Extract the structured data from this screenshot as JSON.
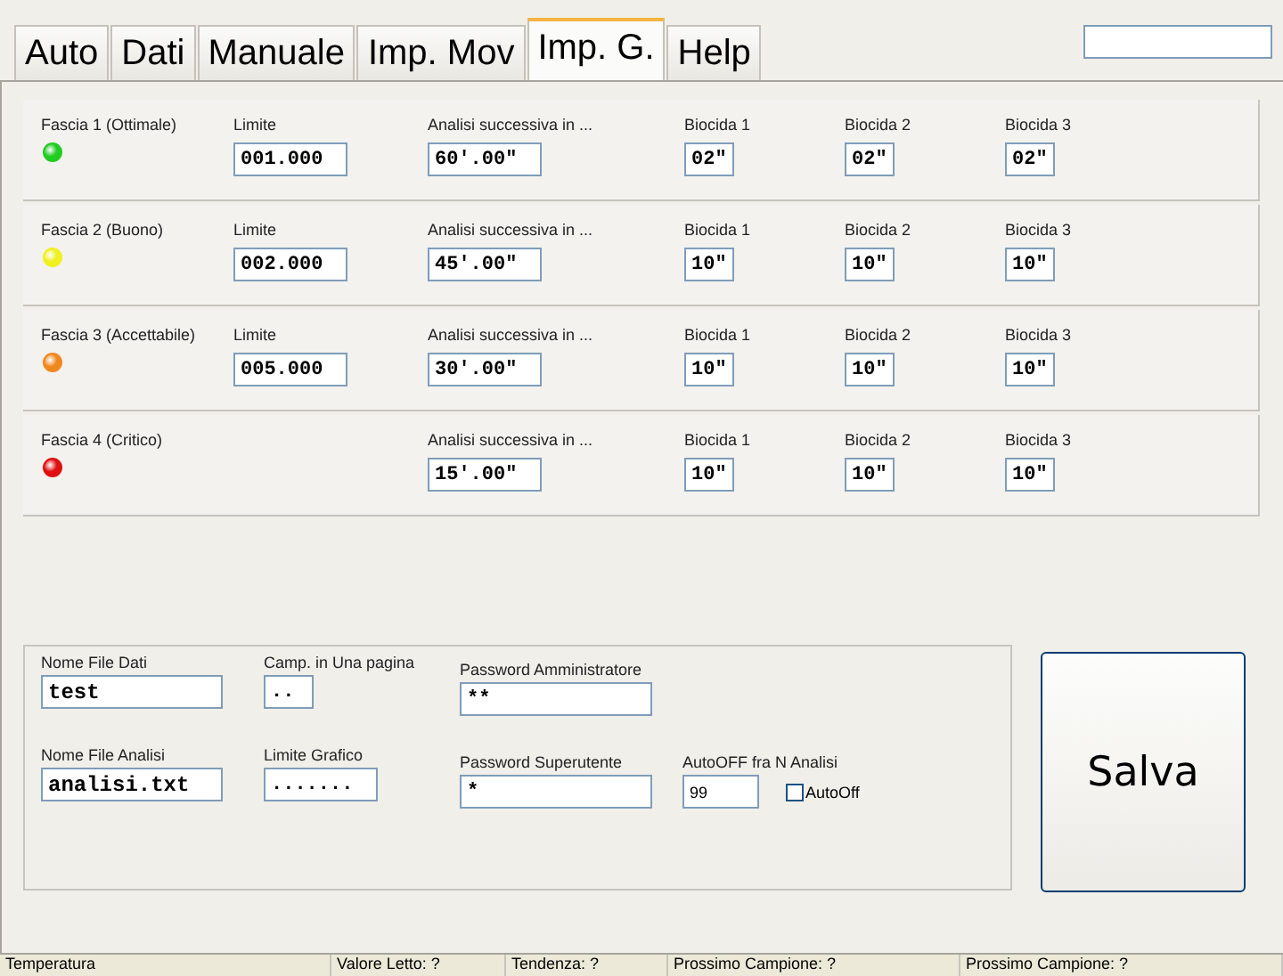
{
  "tabs": [
    {
      "label": "Auto",
      "selected": false
    },
    {
      "label": "Dati",
      "selected": false
    },
    {
      "label": "Manuale",
      "selected": false
    },
    {
      "label": "Imp. Mov",
      "selected": false
    },
    {
      "label": "Imp. G.",
      "selected": true
    },
    {
      "label": "Help",
      "selected": false
    }
  ],
  "bands": [
    {
      "name": "Fascia 1 (Ottimale)",
      "color": "#22cc22",
      "limit": {
        "label": "Limite",
        "value": "001.000"
      },
      "next_analysis": {
        "label": "Analisi successiva in ...",
        "value": "60'.00\""
      },
      "biocides": [
        {
          "label": "Biocida 1",
          "value": "02\""
        },
        {
          "label": "Biocida 2",
          "value": "02\""
        },
        {
          "label": "Biocida 3",
          "value": "02\""
        }
      ]
    },
    {
      "name": "Fascia 2 (Buono)",
      "color": "#f0f020",
      "limit": {
        "label": "Limite",
        "value": "002.000"
      },
      "next_analysis": {
        "label": "Analisi successiva in ...",
        "value": "45'.00\""
      },
      "biocides": [
        {
          "label": "Biocida 1",
          "value": "10\""
        },
        {
          "label": "Biocida 2",
          "value": "10\""
        },
        {
          "label": "Biocida 3",
          "value": "10\""
        }
      ]
    },
    {
      "name": "Fascia 3 (Accettabile)",
      "color": "#f08820",
      "limit": {
        "label": "Limite",
        "value": "005.000"
      },
      "next_analysis": {
        "label": "Analisi successiva in ...",
        "value": "30'.00\""
      },
      "biocides": [
        {
          "label": "Biocida 1",
          "value": "10\""
        },
        {
          "label": "Biocida 2",
          "value": "10\""
        },
        {
          "label": "Biocida 3",
          "value": "10\""
        }
      ]
    },
    {
      "name": "Fascia 4 (Critico)",
      "color": "#e01010",
      "next_analysis": {
        "label": "Analisi successiva in ...",
        "value": "15'.00\""
      },
      "biocides": [
        {
          "label": "Biocida 1",
          "value": "10\""
        },
        {
          "label": "Biocida 2",
          "value": "10\""
        },
        {
          "label": "Biocida 3",
          "value": "10\""
        }
      ]
    }
  ],
  "settings": {
    "data_file": {
      "label": "Nome File Dati",
      "value": "test"
    },
    "samples_per_page": {
      "label": "Camp. in Una pagina",
      "value": ".."
    },
    "admin_password": {
      "label": "Password Amministratore",
      "value": "**"
    },
    "analysis_file": {
      "label": "Nome File Analisi",
      "value": "analisi.txt"
    },
    "chart_limit": {
      "label": "Limite Grafico",
      "value": "......."
    },
    "superuser_password": {
      "label": "Password Superutente",
      "value": "*"
    },
    "autooff_count": {
      "label": "AutoOFF fra N Analisi",
      "value": "99"
    },
    "autooff": {
      "label": "AutoOff",
      "checked": false
    }
  },
  "save_button": "Salva",
  "status_bar": [
    "Temperatura",
    "Valore Letto: ?",
    "Tendenza: ?",
    "Prossimo Campione: ?",
    "Prossimo Campione: ?"
  ]
}
